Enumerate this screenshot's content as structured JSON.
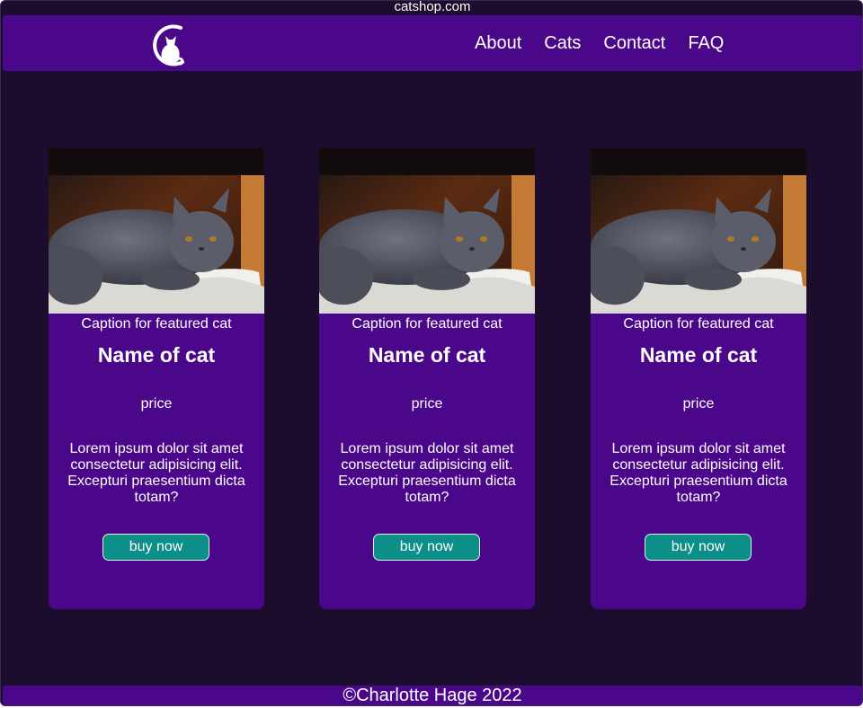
{
  "browser": {
    "url": "catshop.com"
  },
  "nav": {
    "links": [
      {
        "label": "About"
      },
      {
        "label": "Cats"
      },
      {
        "label": "Contact"
      },
      {
        "label": "FAQ"
      }
    ]
  },
  "cards": [
    {
      "caption": "Caption for featured cat",
      "name": "Name of cat",
      "price": "price",
      "description": "Lorem ipsum dolor sit amet consectetur adipisicing elit. Excepturi praesentium dicta totam?",
      "button_label": "buy now"
    },
    {
      "caption": "Caption for featured cat",
      "name": "Name of cat",
      "price": "price",
      "description": "Lorem ipsum dolor sit amet consectetur adipisicing elit. Excepturi praesentium dicta totam?",
      "button_label": "buy now"
    },
    {
      "caption": "Caption for featured cat",
      "name": "Name of cat",
      "price": "price",
      "description": "Lorem ipsum dolor sit amet consectetur adipisicing elit. Excepturi praesentium dicta totam?",
      "button_label": "buy now"
    }
  ],
  "footer": {
    "text": "©Charlotte Hage 2022"
  },
  "icons": {
    "logo": "cat-logo-icon",
    "card_image": "cat-photo"
  },
  "colors": {
    "page_background": "#1c0d2e",
    "brand_purple": "#4b078a",
    "button_teal": "#0c8f88",
    "text": "#ffffff"
  }
}
